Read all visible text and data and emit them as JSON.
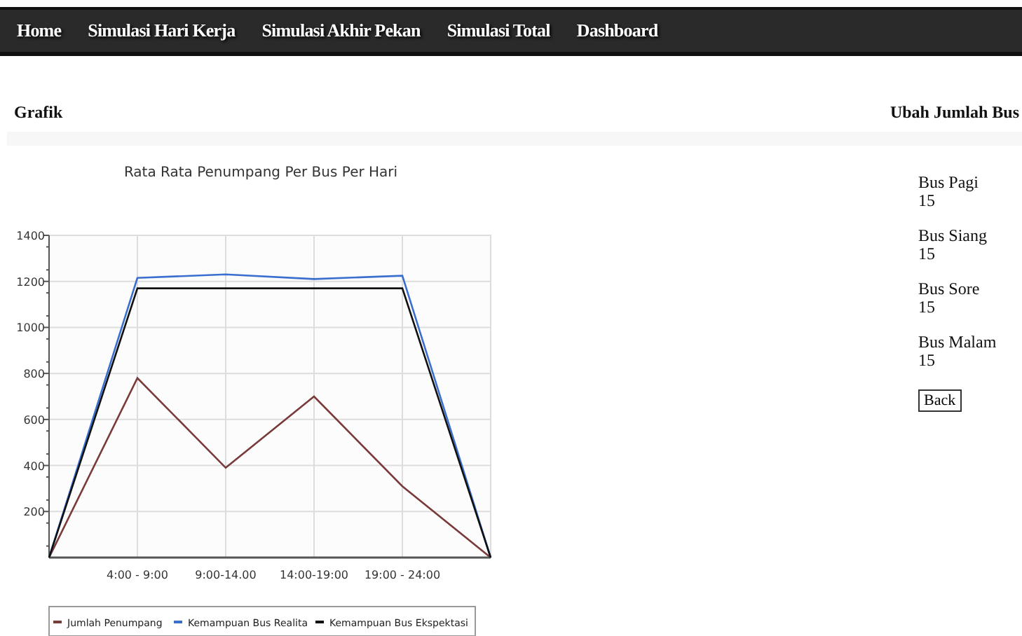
{
  "nav": [
    {
      "label": "Home"
    },
    {
      "label": "Simulasi Hari Kerja"
    },
    {
      "label": "Simulasi Akhir Pekan"
    },
    {
      "label": "Simulasi Total"
    },
    {
      "label": "Dashboard"
    }
  ],
  "left_heading": "Grafik",
  "right_heading": "Ubah Jumlah Bus",
  "chart": {
    "chart_data": {
      "type": "line",
      "title": "Rata Rata Penumpang Per Bus Per Hari",
      "categories": [
        null,
        "4:00 - 9:00",
        "9:00-14.00",
        "14:00-19:00",
        "19:00 - 24:00",
        null
      ],
      "grid": true,
      "legend": true,
      "ylim": [
        0,
        1400
      ],
      "yticks": [
        200,
        400,
        600,
        800,
        1000,
        1200,
        1400
      ],
      "series": [
        {
          "name": "Jumlah Penumpang",
          "color": "#7a3a3a",
          "values": [
            0,
            780,
            390,
            700,
            310,
            0
          ]
        },
        {
          "name": "Kemampuan Bus Realita",
          "color": "#3a6fd0",
          "values": [
            0,
            1215,
            1230,
            1210,
            1225,
            0
          ]
        },
        {
          "name": "Kemampuan Bus Ekspektasi",
          "color": "#111111",
          "values": [
            0,
            1170,
            1170,
            1170,
            1170,
            0
          ]
        }
      ]
    }
  },
  "bus_counts": [
    {
      "label": "Bus Pagi",
      "value": "15"
    },
    {
      "label": "Bus Siang",
      "value": "15"
    },
    {
      "label": "Bus Sore",
      "value": "15"
    },
    {
      "label": "Bus Malam",
      "value": "15"
    }
  ],
  "back_button": "Back"
}
